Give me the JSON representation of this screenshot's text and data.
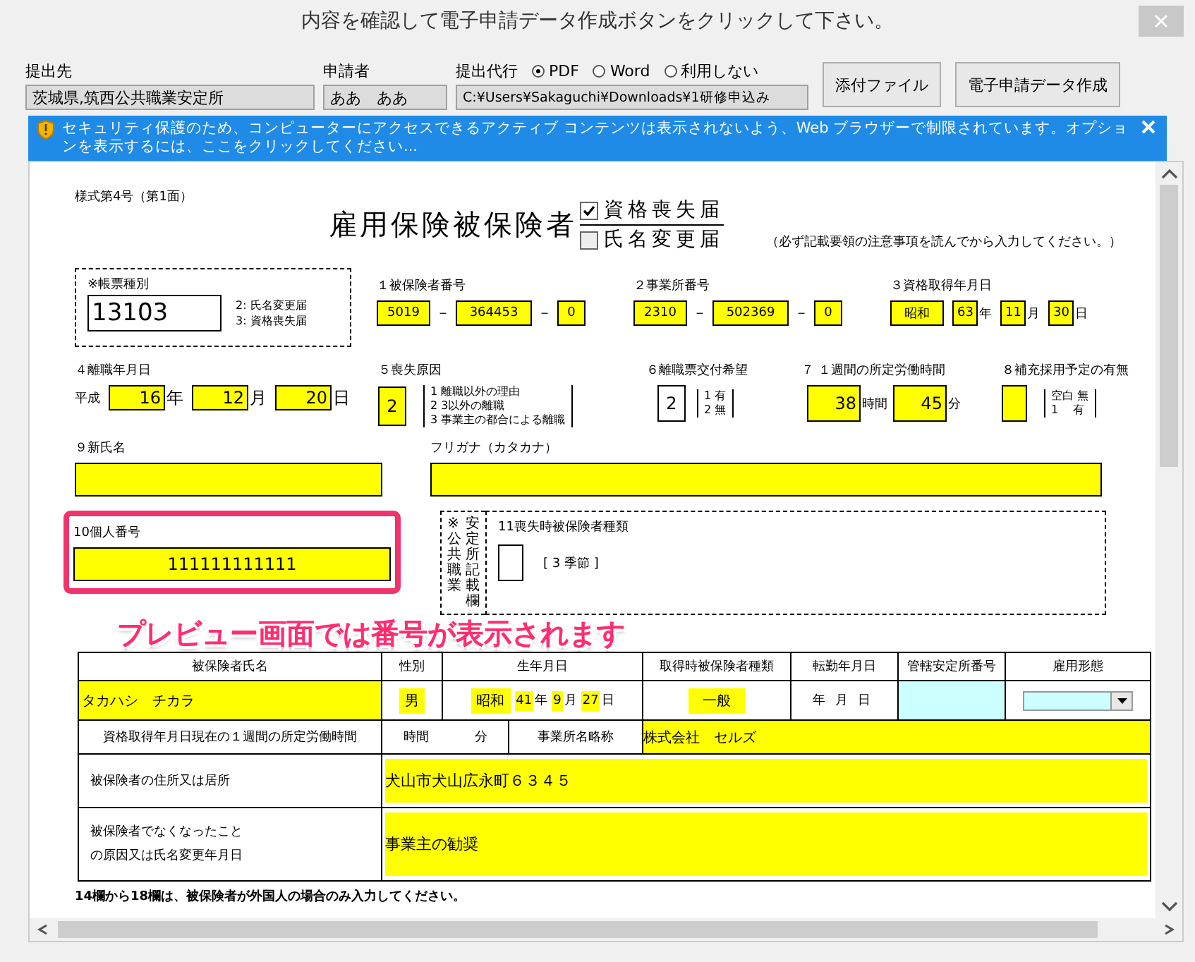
{
  "window": {
    "title": "内容を確認して電子申請データ作成ボタンをクリックして下さい。"
  },
  "header": {
    "fields": [
      {
        "label": "提出先",
        "value": "茨城県,筑西公共職業安定所"
      },
      {
        "label": "申請者",
        "value": "ああ　ああ"
      }
    ],
    "proxy": {
      "label": "提出代行",
      "options": [
        {
          "label": "PDF",
          "selected": true
        },
        {
          "label": "Word",
          "selected": false
        },
        {
          "label": "利用しない",
          "selected": false
        }
      ],
      "value": "C:¥Users¥Sakaguchi¥Downloads¥1研修申込み"
    },
    "buttons": [
      "添付ファイル",
      "電子申請データ作成"
    ]
  },
  "info_bar": {
    "message": "セキュリティ保護のため、コンピューターにアクセスできるアクティブ コンテンツは表示されないよう、Web ブラウザーで制限されています。オプションを表示するには、ここをクリックしてください..."
  },
  "form": {
    "form_number": "様式第4号（第1面）",
    "title": "雇用保険被保険者",
    "notice_types": [
      {
        "label": "資格喪失届",
        "checked": true
      },
      {
        "label": "氏名変更届",
        "checked": false
      }
    ],
    "note": "（必ず記載要領の注意事項を読んでから入力してください。）",
    "slip_type": {
      "label": "※帳票種別",
      "value": "13103",
      "options": [
        "2: 氏名変更届",
        "3: 資格喪失届"
      ]
    },
    "insured_number": {
      "label": "１被保険者番号",
      "parts": [
        "5019",
        "364453",
        "0"
      ],
      "separators": [
        "－",
        "－"
      ]
    },
    "office_number": {
      "label": "２事業所番号",
      "parts": [
        "2310",
        "502369",
        "0"
      ],
      "separators": [
        "－",
        "－"
      ]
    },
    "acquired_date": {
      "label": "３資格取得年月日",
      "era": "昭和",
      "parts": [
        {
          "value": "63",
          "unit": "年"
        },
        {
          "value": "11",
          "unit": "月"
        },
        {
          "value": "30",
          "unit": "日"
        }
      ]
    },
    "separation_date": {
      "label": "４離職年月日",
      "era": "平成",
      "parts": [
        {
          "value": "16",
          "unit": "年"
        },
        {
          "value": "12",
          "unit": "月"
        },
        {
          "value": "20",
          "unit": "日"
        }
      ]
    },
    "loss_reason": {
      "label": "５喪失原因",
      "value": "2",
      "options": [
        "1 離職以外の理由",
        "2 3以外の離職",
        "3 事業主の都合による離職"
      ]
    },
    "separation_slip": {
      "label": "６離職票交付希望",
      "value": "2",
      "options": [
        "1 有",
        "2 無"
      ]
    },
    "weekly_hours": {
      "label": "７ １週間の所定労働時間",
      "parts": [
        {
          "value": "38",
          "unit": "時間"
        },
        {
          "value": "45",
          "unit": "分"
        }
      ]
    },
    "rehire": {
      "label": "８補充採用予定の有無",
      "options": [
        "空白 無",
        "1　 有"
      ]
    },
    "new_name": {
      "label": "９新氏名"
    },
    "furigana": {
      "label": "フリガナ（カタカナ）"
    },
    "my_number": {
      "label": "10個人番号",
      "value": "111111111111"
    },
    "office_use": {
      "columns": [
        "※　公共職業",
        "安定所記載欄"
      ]
    },
    "lost_type": {
      "label": "11喪失時被保険者種類",
      "options": "[ 3 季節 ]"
    },
    "annotation": "プレビュー画面では番号が表示されます",
    "table": {
      "columns": [
        "被保険者氏名",
        "性別",
        "生年月日",
        "取得時被保険者種類",
        "転勤年月日",
        "管轄安定所番号",
        "雇用形態"
      ],
      "person": {
        "name": "タカハシ　チカラ",
        "sex": "男",
        "birth_era": "昭和",
        "birth": [
          {
            "value": "41",
            "unit": "年"
          },
          {
            "value": "9",
            "unit": "月"
          },
          {
            "value": "27",
            "unit": "日"
          }
        ],
        "type": "一般",
        "transfer_date": [
          "年",
          "月",
          "日"
        ]
      },
      "hours": {
        "label": "資格取得年月日現在の１週間の所定労働時間",
        "units": [
          "時間",
          "分"
        ],
        "office_label": "事業所名略称",
        "office_value": "株式会社　セルズ"
      },
      "address": {
        "label": "被保険者の住所又は居所",
        "value": "犬山市犬山広永町６３４５"
      },
      "reason": {
        "lines": [
          "被保険者でなくなったこと",
          "の原因又は氏名変更年月日"
        ],
        "value": "事業主の勧奨"
      }
    },
    "footnote": "14欄から18欄は、被保険者が外国人の場合のみ入力してください。"
  }
}
